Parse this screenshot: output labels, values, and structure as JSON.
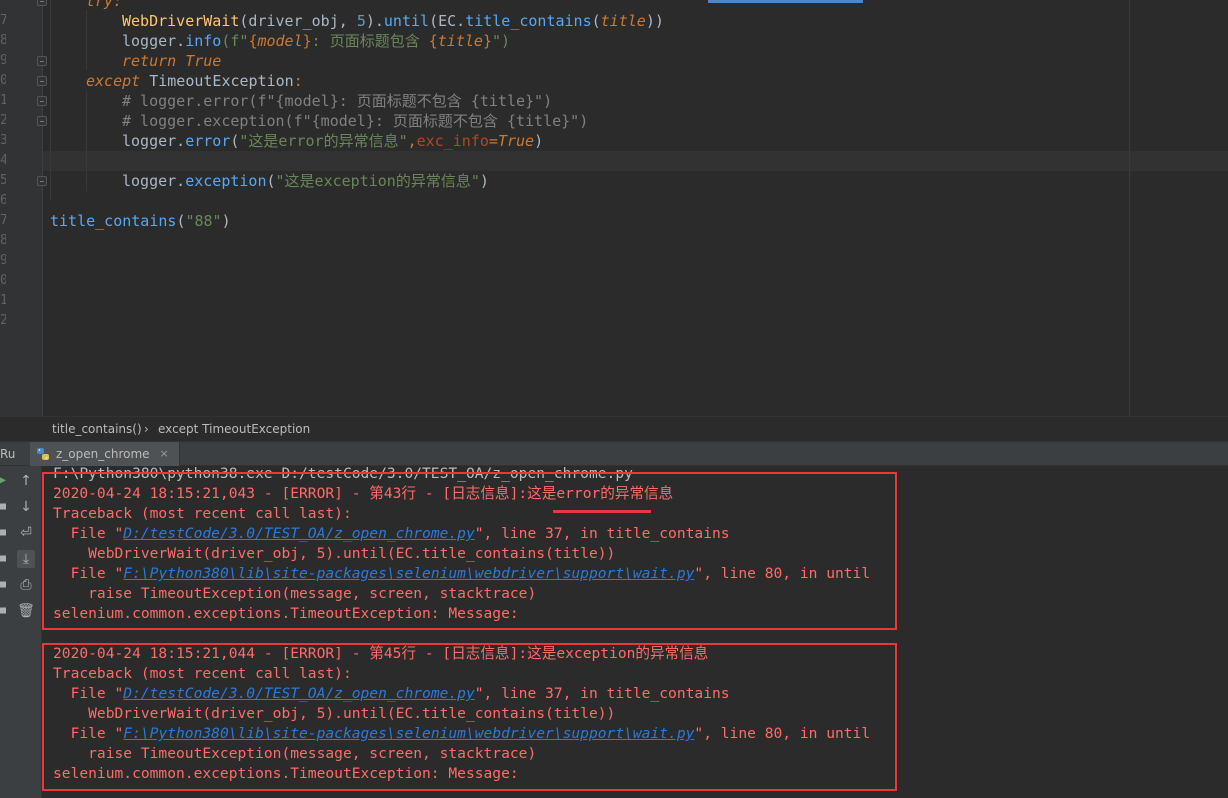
{
  "editor": {
    "line_numbers": [
      "",
      "7",
      "8",
      "9",
      "0",
      "1",
      "2",
      "3",
      "4",
      "5",
      "6",
      "7",
      "8",
      "9",
      "0",
      "1",
      "2"
    ],
    "lines": {
      "l0": "try:",
      "l1_a": "WebDriverWait",
      "l1_b": "(driver_obj, ",
      "l1_c": "5",
      "l1_d": ").",
      "l1_e": "until",
      "l1_f": "(EC.",
      "l1_g": "title_contains",
      "l1_h": "(",
      "l1_i": "title",
      "l1_j": "))",
      "l2_a": "logger.",
      "l2_b": "info",
      "l2_c": "(f\"",
      "l2_d": "{",
      "l2_e": "model",
      "l2_f": "}",
      "l2_g": ": 页面标题包含 ",
      "l2_h": "{",
      "l2_i": "title",
      "l2_j": "}",
      "l2_k": "\")",
      "l3_a": "return ",
      "l3_b": "True",
      "l4_a": "except ",
      "l4_b": "TimeoutException",
      "l4_c": ":",
      "l5": "# logger.error(f\"{model}: 页面标题不包含 {title}\")",
      "l6": "# logger.exception(f\"{model}: 页面标题不包含 {title}\")",
      "l7_a": "logger.",
      "l7_b": "error",
      "l7_c": "(",
      "l7_d": "\"这是error的异常信息\"",
      "l7_e": ",",
      "l7_f": "exc_info",
      "l7_g": "=",
      "l7_h": "True",
      "l7_i": ")",
      "l9_a": "logger.",
      "l9_b": "exception",
      "l9_c": "(",
      "l9_d": "\"这是exception的异常信息\"",
      "l9_e": ")",
      "l11_a": "title_contains",
      "l11_b": "(",
      "l11_c": "\"88\"",
      "l11_d": ")"
    }
  },
  "breadcrumb": {
    "item1": "title_contains()",
    "separator": "›",
    "item2": "except TimeoutException"
  },
  "run_panel": {
    "label": "Run:",
    "tab_label": "z_open_chrome",
    "tab_close": "×",
    "toolbar_icons": [
      "arrow-up-icon",
      "arrow-down-icon",
      "soft-wrap-icon",
      "scroll-to-end-icon",
      "print-icon",
      "trash-icon"
    ]
  },
  "console": {
    "cmd_line": "F:\\Python380\\python38.exe D:/testCode/3.0/TEST_OA/z_open_chrome.py",
    "block1": {
      "header": "2020-04-24 18:15:21,043 - [ERROR] - 第43行 - [日志信息]:这是error的异常信息",
      "traceback": "Traceback (most recent call last):",
      "file1_pre": "  File \"",
      "file1_link": "D:/testCode/3.0/TEST_OA/z_open_chrome.py",
      "file1_post": "\", line 37, in title_contains",
      "code1": "    WebDriverWait(driver_obj, 5).until(EC.title_contains(title))",
      "file2_pre": "  File \"",
      "file2_link": "F:\\Python380\\lib\\site-packages\\selenium\\webdriver\\support\\wait.py",
      "file2_post": "\", line 80, in until",
      "code2": "    raise TimeoutException(message, screen, stacktrace)",
      "exception": "selenium.common.exceptions.TimeoutException: Message:"
    },
    "block2": {
      "header": "2020-04-24 18:15:21,044 - [ERROR] - 第45行 - [日志信息]:这是exception的异常信息",
      "traceback": "Traceback (most recent call last):",
      "file1_pre": "  File \"",
      "file1_link": "D:/testCode/3.0/TEST_OA/z_open_chrome.py",
      "file1_post": "\", line 37, in title_contains",
      "code1": "    WebDriverWait(driver_obj, 5).until(EC.title_contains(title))",
      "file2_pre": "  File \"",
      "file2_link": "F:\\Python380\\lib\\site-packages\\selenium\\webdriver\\support\\wait.py",
      "file2_post": "\", line 80, in until",
      "code2": "    raise TimeoutException(message, screen, stacktrace)",
      "exception": "selenium.common.exceptions.TimeoutException: Message:"
    }
  },
  "colors": {
    "annotation_red": "#e8383d",
    "error_text": "#ff6b68",
    "link": "#287bde"
  }
}
